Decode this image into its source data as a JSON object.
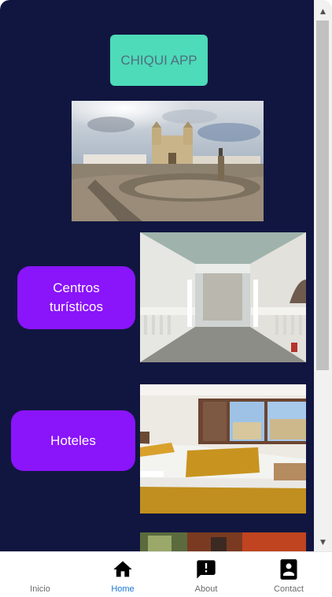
{
  "header": {
    "title": "CHIQUI APP"
  },
  "sections": [
    {
      "label": "Centros\nturísticos",
      "image": "gallery-interior-photo"
    },
    {
      "label": "Hoteles",
      "image": "hotel-room-photo"
    }
  ],
  "hero": {
    "image": "town-square-cathedral-photo"
  },
  "nav": {
    "items": [
      {
        "label": "Inicio",
        "icon": "none",
        "active": false
      },
      {
        "label": "Home",
        "icon": "home-icon",
        "active": true
      },
      {
        "label": "About",
        "icon": "chat-info-icon",
        "active": false
      },
      {
        "label": "Contact",
        "icon": "contact-card-icon",
        "active": false
      }
    ]
  },
  "colors": {
    "background": "#111640",
    "title_button": "#4ddbb9",
    "pill": "#8a14fa",
    "active_nav": "#1976d2"
  }
}
